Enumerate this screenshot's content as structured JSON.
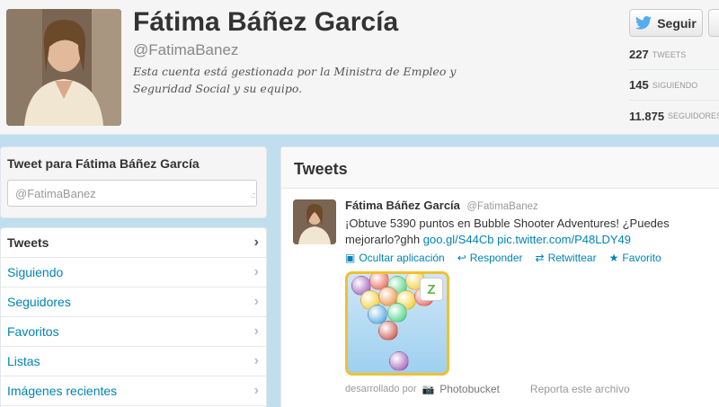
{
  "profile": {
    "name": "Fátima Báñez García",
    "handle": "@FatimaBanez",
    "bio": "Esta cuenta está gestionada por la Ministra de Empleo y Seguridad Social y su equipo."
  },
  "follow_button": {
    "label": "Seguir"
  },
  "stats": [
    {
      "count": "227",
      "label": "TWEETS"
    },
    {
      "count": "145",
      "label": "SIGUIENDO"
    },
    {
      "count": "11.875",
      "label": "SEGUIDORES"
    }
  ],
  "tweet_box": {
    "title": "Tweet para Fátima Báñez García",
    "input_value": "@FatimaBanez"
  },
  "nav": {
    "items": [
      {
        "label": "Tweets"
      },
      {
        "label": "Siguiendo"
      },
      {
        "label": "Seguidores"
      },
      {
        "label": "Favoritos"
      },
      {
        "label": "Listas"
      },
      {
        "label": "Imágenes recientes"
      }
    ]
  },
  "stream": {
    "title": "Tweets"
  },
  "tweet": {
    "name": "Fátima Báñez García",
    "handle": "@FatimaBanez",
    "text": "¡Obtuve 5390 puntos en Bubble Shooter Adventures! ¿Puedes mejorarlo?ghh",
    "link1": "goo.gl/S44Cb",
    "link2": "pic.twitter.com/P48LDY49",
    "actions": {
      "hide": "Ocultar aplicación",
      "reply": "Responder",
      "retweet": "Retwittear",
      "favorite": "Favorito"
    },
    "media": {
      "developed_by": "desarrollado por",
      "provider": "Photobucket",
      "report": "Reporta este archivo"
    }
  },
  "colors": {
    "link": "#0084b4",
    "background": "#c0deed",
    "twitter_blue": "#55acee"
  }
}
